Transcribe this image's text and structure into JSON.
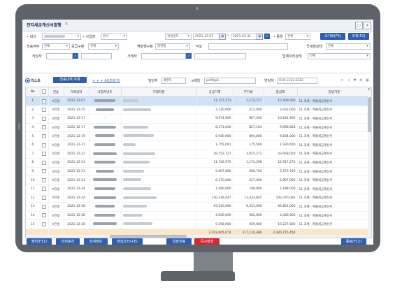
{
  "window": {
    "tab_title": "전자세금계산서발행",
    "tab_close": "×",
    "btn_restore": "▭",
    "btn_close": "×"
  },
  "filters": {
    "company_label": "회사",
    "site_label": "사업장",
    "site_value": "본사",
    "date_type_value": "작성일자",
    "date_from": "2021-12-01",
    "date_to": "2021-03-31",
    "kind_label": "종류",
    "kind_value": "전체",
    "reset_button": "초기화(F5)",
    "search_button": "조회(F2)",
    "send_label": "전송여부",
    "send_value": "전체",
    "issue_label": "공급구분",
    "issue_value": "전체",
    "reverse_label": "역발행구분",
    "reverse_value": "정발행",
    "approval_label": "적요",
    "tax_status_label": "국세청상태",
    "tax_status_value": "전체",
    "writer_label": "작성자",
    "partner_label": "거래처",
    "work_status_label": "업체처리상태",
    "work_status_value": "전체"
  },
  "list": {
    "title": "리스트",
    "btn_delete": "전송내역 삭제",
    "link_add": "+ + + AI(조회기)",
    "manager_label": "담당자",
    "manager_value": "개발자",
    "email_label": "e메일",
    "email_value": "pc99@1",
    "contact_label": "연락처",
    "contact_value": "010-1111-2222",
    "tool_icons": [
      "↔",
      "⇥",
      "▼",
      "⚙",
      "▦"
    ]
  },
  "table": {
    "headers": [
      "No",
      "",
      "전송",
      "거래일자",
      "사업자번호",
      "거래처명",
      "공급가액",
      "부가세",
      "총금액",
      "증빙기준"
    ],
    "rows": [
      {
        "no": "1",
        "send": "V전송",
        "date": "2021-12-07",
        "supply": "11,727,273",
        "vat": "1,172,727",
        "total": "12,900,000",
        "basis": "11.과세 - 매출세금계산서",
        "selected": true
      },
      {
        "no": "2",
        "send": "V전송",
        "date": "2021-12-15",
        "supply": "3,120,000",
        "vat": "312,000",
        "total": "3,432,000",
        "basis": "11.과세 - 매출세금계산서",
        "selected": false
      },
      {
        "no": "3",
        "send": "V전송",
        "date": "2021-12-17",
        "supply": "9,674,000",
        "vat": "967,400",
        "total": "10,641,400",
        "basis": "11.과세 - 매출세금계산서",
        "selected": false
      },
      {
        "no": "4",
        "send": "V전송",
        "date": "2021-12-17",
        "supply": "8,271,640",
        "vat": "827,164",
        "total": "9,098,804",
        "basis": "11.과세 - 매출세금계산서",
        "selected": false
      },
      {
        "no": "5",
        "send": "V전송",
        "date": "2021-12-19",
        "supply": "8,940,000",
        "vat": "894,000",
        "total": "9,834,000",
        "basis": "11.과세 - 매출세금계산서",
        "selected": false
      },
      {
        "no": "6",
        "send": "V전송",
        "date": "2021-12-21",
        "supply": "1,755,091",
        "vat": "175,509",
        "total": "1,930,600",
        "basis": "11.과세 - 매출세금계산서",
        "selected": false
      },
      {
        "no": "7",
        "send": "V전송",
        "date": "2021-12-22",
        "supply": "39,152,727",
        "vat": "3,915,273",
        "total": "43,068,000",
        "basis": "11.과세 - 매출세금계산서",
        "selected": false
      },
      {
        "no": "8",
        "send": "V전송",
        "date": "2021-12-23",
        "supply": "11,742,975",
        "vat": "1,174,298",
        "total": "12,917,273",
        "basis": "11.과세 - 매출세금계산서",
        "selected": false
      },
      {
        "no": "9",
        "send": "V전송",
        "date": "2021-12-23",
        "supply": "5,067,000",
        "vat": "506,700",
        "total": "5,573,700",
        "basis": "11.과세 - 매출세금계산서",
        "selected": false
      },
      {
        "no": "10",
        "send": "V전송",
        "date": "2021-12-24",
        "supply": "6,270,000",
        "vat": "627,000",
        "total": "6,897,000",
        "basis": "11.과세 - 매출세금계산서",
        "selected": false
      },
      {
        "no": "11",
        "send": "V전송",
        "date": "2021-12-24",
        "supply": "1,080,000",
        "vat": "108,000",
        "total": "1,188,000",
        "basis": "11.과세 - 매출세금계산서",
        "selected": false
      },
      {
        "no": "12",
        "send": "V전송",
        "date": "2021-12-24",
        "supply": "130,336,447",
        "vat": "13,033,645",
        "total": "143,370,092",
        "basis": "11.과세 - 매출세금계산서",
        "selected": false
      },
      {
        "no": "13",
        "send": "V전송",
        "date": "2021-12-28",
        "supply": "63,510,000",
        "vat": "6,351,000",
        "total": "69,861,000",
        "basis": "11.과세 - 매출세금계산서",
        "selected": false
      },
      {
        "no": "14",
        "send": "V전송",
        "date": "2021-12-28",
        "supply": "4,026,000",
        "vat": "402,600",
        "total": "4,428,600",
        "basis": "11.과세 - 매출세금계산서",
        "selected": false
      },
      {
        "no": "15",
        "send": "V전송",
        "date": "2021-12-28",
        "supply": "9,298,000",
        "vat": "929,800",
        "total": "10,227,800",
        "basis": "11.과세 - 매출세금계산서",
        "selected": false
      }
    ],
    "sum_supply": "2,203,605,074",
    "sum_vat": "217,110,380",
    "sum_total": "2,420,715,454"
  },
  "footer": {
    "btn_print": "출력(F11)",
    "btn_preview": "미전송건",
    "btn_detail": "상세정보",
    "btn_edit": "편집(Ctrl+E)",
    "btn_send": "일괄전송",
    "btn_issue": "즉시발행",
    "btn_close": "종료(F12)"
  }
}
